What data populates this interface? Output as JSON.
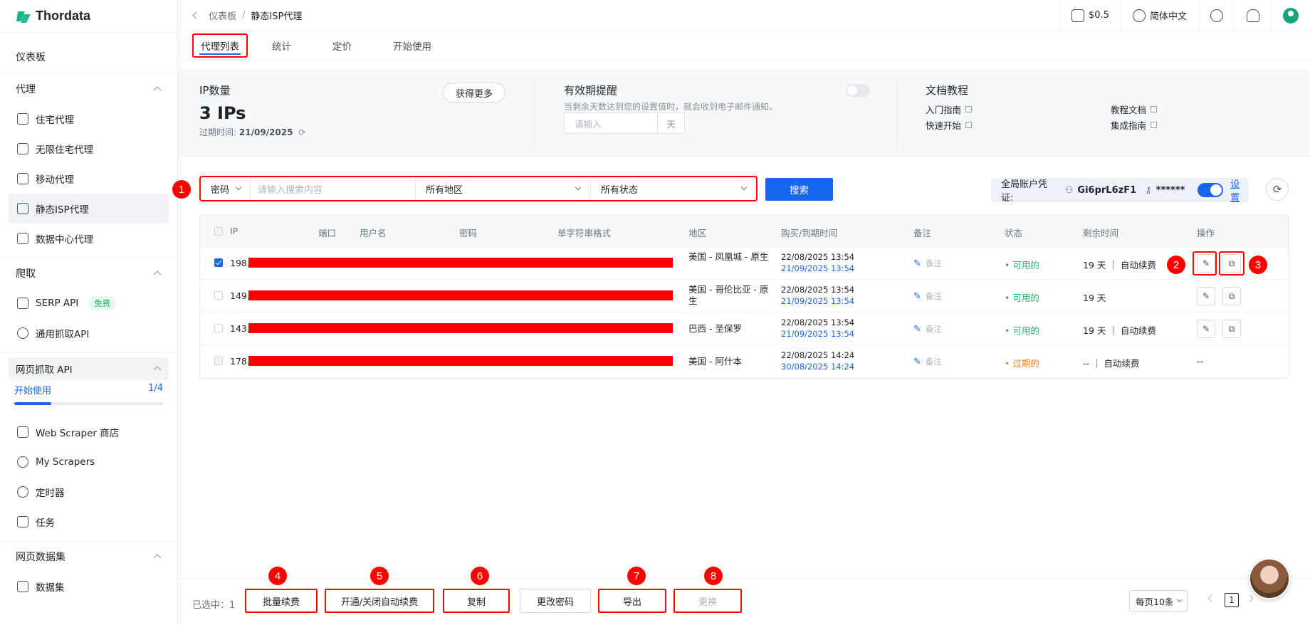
{
  "brand": {
    "name": "Thordata"
  },
  "sidebar": {
    "dashboard": "仪表板",
    "proxy_group": {
      "title": "代理",
      "items": [
        "住宅代理",
        "无限住宅代理",
        "移动代理",
        "静态ISP代理",
        "数据中心代理"
      ]
    },
    "crawl_group": {
      "title": "爬取",
      "serp": "SERP API",
      "serp_badge": "免费",
      "universal": "通用抓取API"
    },
    "web_api": {
      "title": "网页抓取 API",
      "start_label": "开始使用",
      "progress_text": "1/4",
      "progress": 0.25,
      "items": [
        "Web Scraper 商店",
        "My Scrapers",
        "定时器",
        "任务"
      ]
    },
    "dataset_group": {
      "title": "网页数据集",
      "items": [
        "数据集"
      ]
    }
  },
  "topbar": {
    "breadcrumb": [
      "仪表板",
      "静态ISP代理"
    ],
    "separator": "/",
    "balance": "$0.5",
    "language": "简体中文"
  },
  "tabs": [
    "代理列表",
    "统计",
    "定价",
    "开始使用"
  ],
  "summary": {
    "ip_title": "IP数量",
    "ip_count": "3 IPs",
    "expire_label": "过期时间:",
    "expire_date": "21/09/2025",
    "get_more": "获得更多",
    "reminder_title": "有效期提醒",
    "reminder_desc": "当剩余天数达到您的设置值时，就会收到电子邮件通知。",
    "reminder_placeholder": "请输入",
    "reminder_unit": "天",
    "docs_title": "文档教程",
    "docs": [
      "入门指南",
      "快速开始",
      "教程文档",
      "集成指南"
    ]
  },
  "filters": {
    "type": "密码",
    "search_placeholder": "请输入搜索内容",
    "region": "所有地区",
    "status": "所有状态",
    "search_button": "搜索",
    "cred_label": "全局账户凭证:",
    "cred_user": "Gi6prL6zF1",
    "cred_pass": "******",
    "cred_setting": "设置"
  },
  "table": {
    "headers": [
      "IP",
      "端口",
      "用户名",
      "密码",
      "单字符串格式",
      "地区",
      "购买/到期时间",
      "备注",
      "状态",
      "剩余时间",
      "操作"
    ],
    "remark_label": "备注",
    "rows": [
      {
        "ip_prefix": "198.",
        "region": "美国 - 凤凰城 - 原生",
        "buy": "22/08/2025 13:54",
        "expire": "21/09/2025 13:54",
        "status": "可用的",
        "status_type": "ok",
        "remaining": "19 天 ｜ 自动续费",
        "actions": true,
        "checked": true
      },
      {
        "ip_prefix": "149.",
        "region": "美国 - 哥伦比亚 - 原生",
        "buy": "22/08/2025 13:54",
        "expire": "21/09/2025 13:54",
        "status": "可用的",
        "status_type": "ok",
        "remaining": "19 天",
        "actions": true,
        "checked": false
      },
      {
        "ip_prefix": "143.",
        "region": "巴西 - 圣保罗",
        "buy": "22/08/2025 13:54",
        "expire": "21/09/2025 13:54",
        "status": "可用的",
        "status_type": "ok",
        "remaining": "19 天 ｜ 自动续费",
        "actions": true,
        "checked": false
      },
      {
        "ip_prefix": "178.",
        "region": "美国 - 阿什本",
        "buy": "22/08/2025 14:24",
        "expire": "30/08/2025 14:24",
        "status": "过期的",
        "status_type": "exp",
        "remaining": "-- ｜ 自动续费",
        "actions": false,
        "action_text": "--",
        "checked": false
      }
    ]
  },
  "bottom": {
    "selected_label": "已选中：",
    "selected_count": "1",
    "buttons": [
      "批量续费",
      "开通/关闭自动续费",
      "复制",
      "更改密码",
      "导出",
      "更换"
    ],
    "page_size": "每页10条",
    "page": "1"
  },
  "markers": [
    "1",
    "2",
    "3",
    "4",
    "5",
    "6",
    "7",
    "8"
  ],
  "colors": {
    "accent": "#1766f0",
    "ok": "#23b26d",
    "expired": "#ff7a1a",
    "annotation": "#ff0000"
  }
}
